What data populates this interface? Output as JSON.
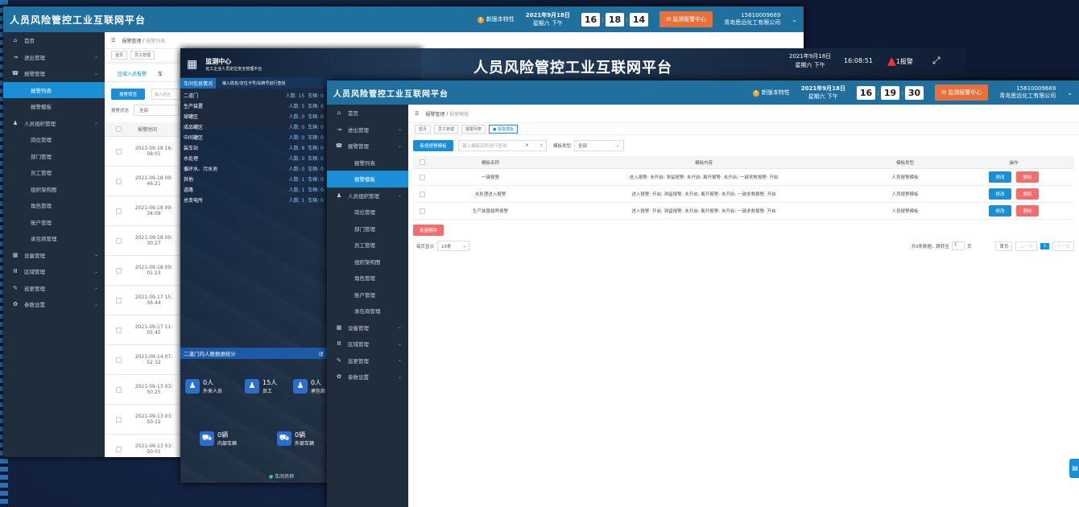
{
  "platform_title": "人员风险管控工业互联网平台",
  "header": {
    "new_features": "新版本特性",
    "date": "2021年9月18日",
    "weekday": "星期六 下午",
    "alarm_center": "监测报警中心",
    "phone": "15610009669",
    "company": "青岛思远化工有限公司"
  },
  "w1": {
    "time": [
      "16",
      "18",
      "14"
    ],
    "breadcrumb": [
      "报警管理",
      "报警列表"
    ],
    "tabs": [
      "首页",
      "员工管理"
    ],
    "subtabs": [
      "区域人员报警",
      "车"
    ],
    "alarm_btn": "报警筛查",
    "search_placeholder": "输入姓名",
    "status_label": "报警状态",
    "status_value": "全部",
    "col_time": "报警时间",
    "rows": [
      "2021-09-18 16:\n08:01",
      "2021-09-18 09:\n46:21",
      "2021-09-18 09:\n34:09",
      "2021-09-18 09:\n30:27",
      "2021-09-18 09:\n01:23",
      "2021-09-17 15:\n56:44",
      "2021-09-17 11:\n05:45",
      "2021-09-14 07:\n52:32",
      "2021-09-13 03:\n50:25",
      "2021-09-13 03:\n50:12",
      "2021-09-13 03:\n50:01"
    ]
  },
  "sidebar": {
    "items": [
      {
        "icon": "home-icon",
        "glyph": "⌂",
        "label": "首页",
        "type": "top"
      },
      {
        "icon": "inout-icon",
        "glyph": "⇥",
        "label": "进出管理",
        "type": "top",
        "chev": true
      },
      {
        "icon": "alarm-icon",
        "glyph": "☎",
        "label": "报警管理",
        "type": "top",
        "chev": true
      },
      {
        "label": "报警列表",
        "type": "sub",
        "active_w1": true
      },
      {
        "label": "报警模板",
        "type": "sub",
        "active_w3": true
      },
      {
        "icon": "person-icon",
        "glyph": "♟",
        "label": "人员组织管理",
        "type": "top",
        "chev": true
      },
      {
        "label": "岗位管理",
        "type": "sub"
      },
      {
        "label": "部门管理",
        "type": "sub"
      },
      {
        "label": "员工管理",
        "type": "sub"
      },
      {
        "label": "组织架构图",
        "type": "sub"
      },
      {
        "label": "角色管理",
        "type": "sub"
      },
      {
        "label": "账户管理",
        "type": "sub"
      },
      {
        "label": "承包商管理",
        "type": "sub"
      },
      {
        "icon": "device-icon",
        "glyph": "▦",
        "label": "设备管理",
        "type": "top",
        "chev": true
      },
      {
        "icon": "area-icon",
        "glyph": "Ⅲ",
        "label": "区域管理",
        "type": "top",
        "chev": true
      },
      {
        "icon": "patrol-icon",
        "glyph": "✎",
        "label": "巡更管理",
        "type": "top",
        "chev": true
      },
      {
        "icon": "gear-icon",
        "glyph": "✿",
        "label": "参数设置",
        "type": "top",
        "chev": true
      }
    ]
  },
  "w2": {
    "title": "监测中心",
    "subtitle": "化工企业人员定位安全管理平台",
    "date": "2021年9月18日",
    "weekday": "星期六 下午",
    "time": "16:08:51",
    "alarm": "1报警",
    "vehicle_tab": "车间信息情况",
    "vehicle_search": "输入姓名/定位卡号/车牌号进行查找",
    "zones": [
      {
        "name": "二道门",
        "people": "人数: 15",
        "car": "车辆: 0"
      },
      {
        "name": "生产装置",
        "people": "人数: 5",
        "car": "车辆: 0"
      },
      {
        "name": "球罐区",
        "people": "人数: 0",
        "car": "车辆: 0"
      },
      {
        "name": "成品罐区",
        "people": "人数: 0",
        "car": "车辆: 0"
      },
      {
        "name": "中间罐区",
        "people": "人数: 0",
        "car": "车辆: 0"
      },
      {
        "name": "装车站",
        "people": "人数: 8",
        "car": "车辆: 0"
      },
      {
        "name": "水处理",
        "people": "人数: 0",
        "car": "车辆: 0"
      },
      {
        "name": "循环水、污水池",
        "people": "人数: 0",
        "car": "车辆: 0"
      },
      {
        "name": "其他",
        "people": "人数: 1",
        "car": "车辆: 0"
      },
      {
        "name": "道路",
        "people": "人数: 1",
        "car": "车辆: 0"
      },
      {
        "name": "总变电所",
        "people": "人数: 1",
        "car": "车辆: 0"
      }
    ],
    "stat_title": "二道门内人数数据统计",
    "stat_more": "详",
    "stats": [
      {
        "v": "0人",
        "l": "外来人员"
      },
      {
        "v": "15人",
        "l": "员工"
      },
      {
        "v": "0人",
        "l": "承包商"
      },
      {
        "v": "0辆",
        "l": "内部车辆"
      },
      {
        "v": "0辆",
        "l": "外部车辆"
      }
    ],
    "footer": "车间名称"
  },
  "w3": {
    "time": [
      "16",
      "19",
      "30"
    ],
    "breadcrumb": [
      "报警管理",
      "报警模板"
    ],
    "tabs": [
      "首页",
      "员工管理",
      "报警列表",
      "● 报警模板"
    ],
    "add_btn": "新增报警模板",
    "search_placeholder": "输入模板名称进行查询",
    "type_label": "模板类型",
    "type_value": "全部",
    "cols": [
      "模板名称",
      "模板内容",
      "模板类型",
      "操作"
    ],
    "rows": [
      {
        "name": "一键报警",
        "content": "进入报警: 未开启; 滞留报警: 未开启; 离开报警: 未开启; 一键求救报警: 开启",
        "type": "人员报警模板"
      },
      {
        "name": "水处理进入报警",
        "content": "进入报警: 开启; 滞留报警: 未开启; 离开报警: 未开启; 一键求救报警: 开启",
        "type": "人员报警模板"
      },
      {
        "name": "生产装置越界报警",
        "content": "进入报警: 开启; 滞留报警: 未开启; 离开报警: 未开启; 一键求救报警: 开启",
        "type": "人员报警模板"
      }
    ],
    "edit": "修改",
    "del": "删除",
    "batch_del": "批量删除",
    "per_page_label": "每页显示",
    "per_page": "15条",
    "total": "共3条数据，跳转至",
    "page_input": "1",
    "page_unit": "页",
    "first": "首页",
    "prev": "上一页",
    "page": "1",
    "next": "下一页"
  }
}
